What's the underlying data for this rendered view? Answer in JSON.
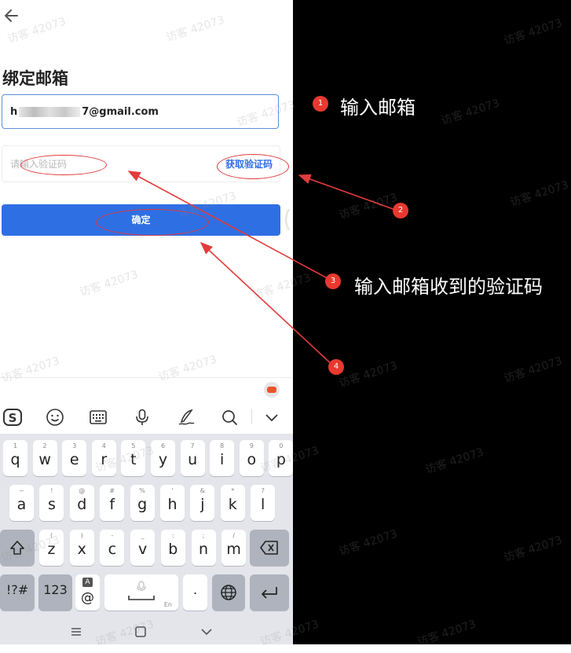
{
  "header": {
    "back_icon": "arrow-left-icon",
    "title": "绑定邮箱"
  },
  "form": {
    "email_prefix": "h",
    "email_suffix": "7@gmail.com",
    "code_placeholder": "请输入验证码",
    "get_code_label": "获取验证码",
    "confirm_label": "确定"
  },
  "keyboard": {
    "toolbar_icons": [
      "sogou-logo-icon",
      "emoji-icon",
      "keyboard-icon",
      "microphone-icon",
      "handwriting-icon",
      "search-icon",
      "chevron-down-icon"
    ],
    "row1": [
      {
        "key": "q",
        "hint": "1"
      },
      {
        "key": "w",
        "hint": "2"
      },
      {
        "key": "e",
        "hint": "3"
      },
      {
        "key": "r",
        "hint": "4"
      },
      {
        "key": "t",
        "hint": "5"
      },
      {
        "key": "y",
        "hint": "6"
      },
      {
        "key": "u",
        "hint": "7"
      },
      {
        "key": "i",
        "hint": "8"
      },
      {
        "key": "o",
        "hint": "9"
      },
      {
        "key": "p",
        "hint": "0"
      }
    ],
    "row2": [
      {
        "key": "a",
        "hint": "~"
      },
      {
        "key": "s",
        "hint": "!"
      },
      {
        "key": "d",
        "hint": "@"
      },
      {
        "key": "f",
        "hint": "#"
      },
      {
        "key": "g",
        "hint": "%"
      },
      {
        "key": "h",
        "hint": "'"
      },
      {
        "key": "j",
        "hint": "&"
      },
      {
        "key": "k",
        "hint": "*"
      },
      {
        "key": "l",
        "hint": "?"
      }
    ],
    "row3": [
      {
        "key": "z",
        "hint": "("
      },
      {
        "key": "x",
        "hint": ")"
      },
      {
        "key": "c",
        "hint": "-"
      },
      {
        "key": "v",
        "hint": "_"
      },
      {
        "key": "b",
        "hint": ":"
      },
      {
        "key": "n",
        "hint": ";"
      },
      {
        "key": "m",
        "hint": "/"
      }
    ],
    "symbols_label": "!?#",
    "numbers_label": "123",
    "at_label": "@",
    "at_hint": "A",
    "space_hint": "En",
    "period_label": ".",
    "shift_icon": "shift-icon",
    "backspace_icon": "backspace-icon",
    "globe_icon": "globe-icon",
    "enter_icon": "enter-icon"
  },
  "nav_bar": {
    "icons": [
      "menu-icon",
      "home-icon",
      "back-chevron-icon"
    ]
  },
  "annotations": [
    {
      "number": "1",
      "text": "输入邮箱"
    },
    {
      "number": "2",
      "text": ""
    },
    {
      "number": "3",
      "text": "输入邮箱收到的验证码"
    },
    {
      "number": "4",
      "text": ""
    }
  ],
  "watermark": "访客 42073",
  "colors": {
    "accent": "#2f6fe4",
    "annotation": "#e8392f",
    "focus_border": "#5b8fd9"
  }
}
